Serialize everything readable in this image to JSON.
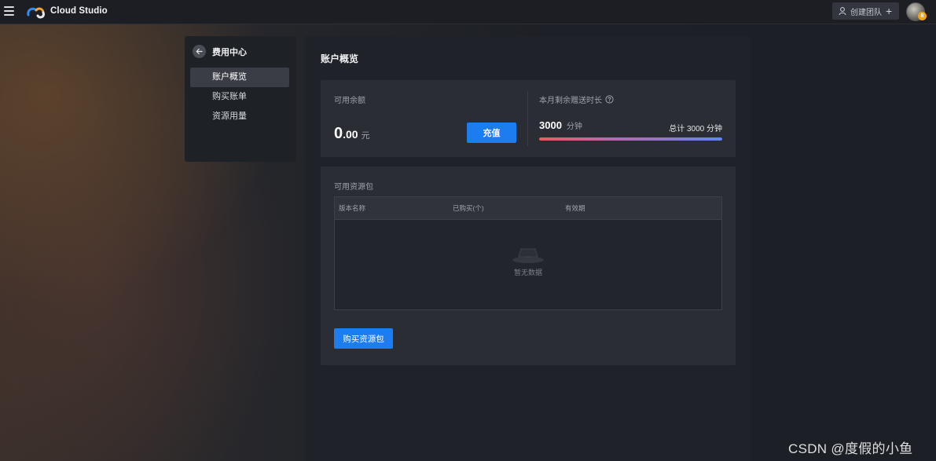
{
  "header": {
    "brand": "Cloud Studio",
    "create_team_label": "创建团队",
    "avatar_badge": "8"
  },
  "sidebar": {
    "title": "费用中心",
    "items": [
      {
        "label": "账户概览",
        "active": true
      },
      {
        "label": "购买账单",
        "active": false
      },
      {
        "label": "资源用量",
        "active": false
      }
    ]
  },
  "main": {
    "title": "账户概览",
    "balance": {
      "label": "可用余额",
      "integer": "0",
      "decimal": ".00",
      "unit": "元",
      "recharge_label": "充值"
    },
    "free_time": {
      "label": "本月剩余赠送时长",
      "value": "3000",
      "unit": "分钟",
      "total_label": "总计 3000 分钟",
      "progress_fraction": 1.0
    },
    "resources": {
      "label": "可用资源包",
      "columns": [
        "版本名称",
        "已购买(个)",
        "有效期"
      ],
      "rows": [],
      "empty_text": "暂无数据",
      "buy_label": "购买资源包"
    }
  },
  "watermark": "CSDN @度假的小鱼",
  "colors": {
    "accent": "#1c7df0",
    "badge": "#f2a31b",
    "progress_start": "#e05f5f",
    "progress_end": "#5f87e8"
  },
  "icons": [
    "menu-icon",
    "cloud-studio-logo-icon",
    "user-icon",
    "plus-icon",
    "back-arrow-icon",
    "help-circle-icon",
    "empty-box-icon"
  ]
}
